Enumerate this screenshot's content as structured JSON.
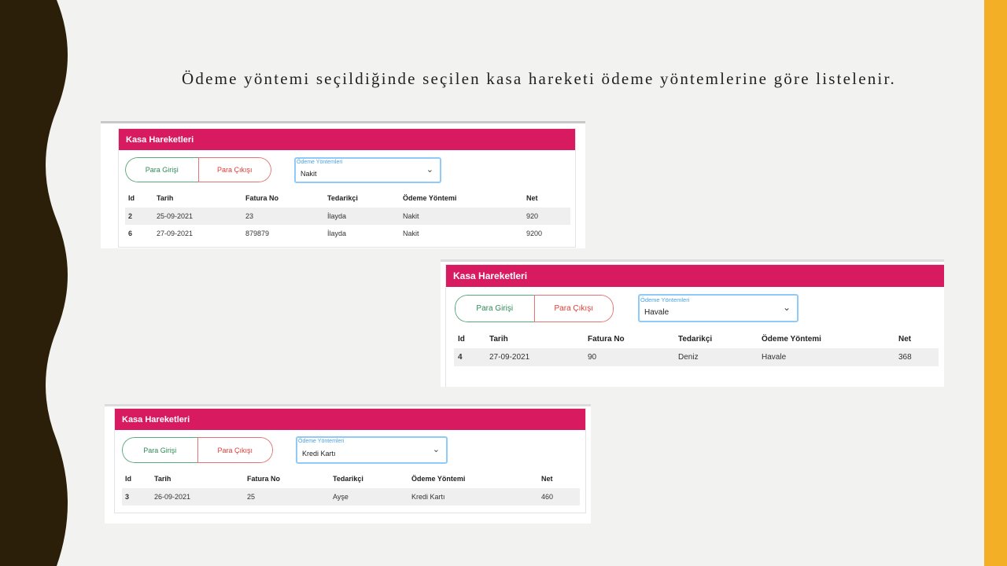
{
  "slide": {
    "title": "Ödeme yöntemi seçildiğinde seçilen kasa hareketi ödeme yöntemlerine göre listelenir.",
    "colors": {
      "band_left": "#2b1f0a",
      "band_right": "#f3b026",
      "header": "#d81b60",
      "background": "#f2f2f0"
    }
  },
  "screens": [
    {
      "header": "Kasa Hareketleri",
      "btn_in": "Para Girişi",
      "btn_out": "Para Çıkışı",
      "select_label": "Ödeme Yöntemleri",
      "select_value": "Nakit",
      "columns": [
        "Id",
        "Tarih",
        "Fatura No",
        "Tedarikçi",
        "Ödeme Yöntemi",
        "Net"
      ],
      "rows": [
        [
          "2",
          "25-09-2021",
          "23",
          "İlayda",
          "Nakit",
          "920"
        ],
        [
          "6",
          "27-09-2021",
          "879879",
          "İlayda",
          "Nakit",
          "9200"
        ]
      ]
    },
    {
      "header": "Kasa Hareketleri",
      "btn_in": "Para Girişi",
      "btn_out": "Para Çıkışı",
      "select_label": "Ödeme Yöntemleri",
      "select_value": "Havale",
      "columns": [
        "Id",
        "Tarih",
        "Fatura No",
        "Tedarikçi",
        "Ödeme Yöntemi",
        "Net"
      ],
      "rows": [
        [
          "4",
          "27-09-2021",
          "90",
          "Deniz",
          "Havale",
          "368"
        ]
      ]
    },
    {
      "header": "Kasa Hareketleri",
      "btn_in": "Para Girişi",
      "btn_out": "Para Çıkışı",
      "select_label": "Ödeme Yöntemleri",
      "select_value": "Kredi Kartı",
      "columns": [
        "Id",
        "Tarih",
        "Fatura No",
        "Tedarikçi",
        "Ödeme Yöntemi",
        "Net"
      ],
      "rows": [
        [
          "3",
          "26-09-2021",
          "25",
          "Ayşe",
          "Kredi Kartı",
          "460"
        ]
      ]
    }
  ]
}
